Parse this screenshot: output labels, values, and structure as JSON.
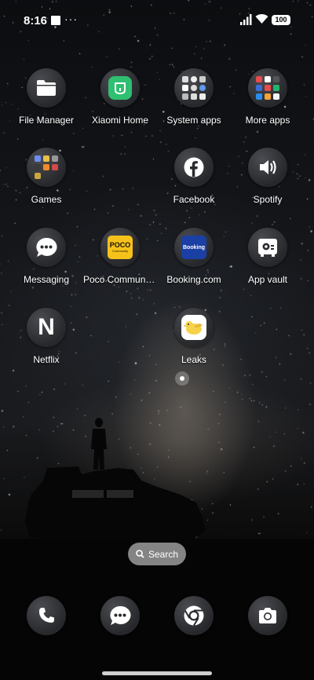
{
  "status_bar": {
    "time": "8:16",
    "overflow": "···",
    "battery": "100"
  },
  "apps": [
    {
      "label": "File Manager",
      "icon": "folder-icon"
    },
    {
      "label": "Xiaomi Home",
      "icon": "xiaomi-home-icon"
    },
    {
      "label": "System apps",
      "icon": "folder-system-apps-icon"
    },
    {
      "label": "More apps",
      "icon": "folder-more-apps-icon"
    },
    {
      "label": "Games",
      "icon": "folder-games-icon"
    },
    {
      "label": "Facebook",
      "icon": "facebook-icon"
    },
    {
      "label": "Spotify",
      "icon": "spotify-icon"
    },
    {
      "label": "Messaging",
      "icon": "messaging-icon"
    },
    {
      "label": "Poco Communi…",
      "icon": "poco-community-icon"
    },
    {
      "label": "Booking.com",
      "icon": "booking-icon"
    },
    {
      "label": "App vault",
      "icon": "app-vault-icon"
    },
    {
      "label": "Netflix",
      "icon": "netflix-icon"
    },
    {
      "label": "Leaks",
      "icon": "leaks-bird-icon"
    }
  ],
  "icon_text": {
    "poco": "POCO",
    "poco_sub": "Community",
    "booking": "Booking",
    "netflix": "N"
  },
  "search": {
    "label": "Search"
  },
  "dock": [
    {
      "icon": "phone-icon"
    },
    {
      "icon": "messages-icon"
    },
    {
      "icon": "chrome-icon"
    },
    {
      "icon": "camera-icon"
    }
  ],
  "colors": {
    "xiaomi_green": "#2fbf71",
    "poco_yellow": "#f6c21a",
    "booking_blue": "#1a3fa5",
    "leaks_yellow": "#f5d24a"
  }
}
